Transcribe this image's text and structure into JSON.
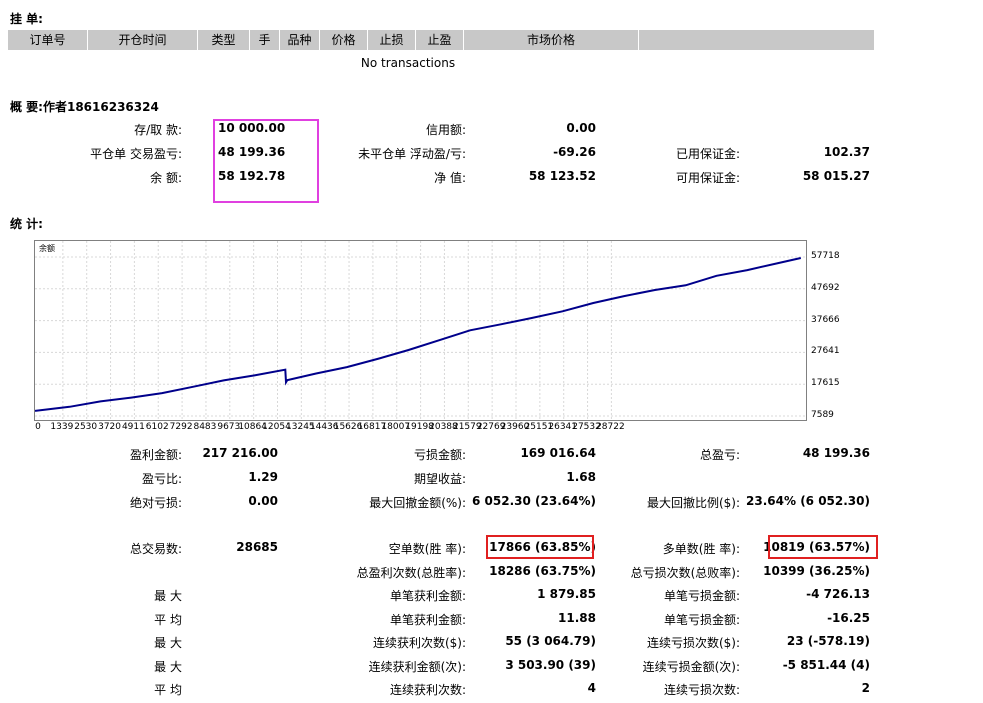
{
  "pending": {
    "title": "挂 单:",
    "columns": [
      "订单号",
      "开仓时间",
      "类型",
      "手",
      "品种",
      "价格",
      "止损",
      "止盈",
      "市场价格",
      ""
    ],
    "empty_text": "No transactions"
  },
  "summary": {
    "title": "概 要:作者18616236324",
    "rows": [
      [
        {
          "label": "存/取 款:",
          "value": "10 000.00"
        },
        {
          "label": "信用额:",
          "value": "0.00"
        },
        {
          "label": "",
          "value": ""
        }
      ],
      [
        {
          "label": "平仓单 交易盈亏:",
          "value": "48 199.36"
        },
        {
          "label": "未平仓单 浮动盈/亏:",
          "value": "-69.26"
        },
        {
          "label": "已用保证金:",
          "value": "102.37"
        }
      ],
      [
        {
          "label": "余 额:",
          "value": "58 192.78"
        },
        {
          "label": "净 值:",
          "value": "58 123.52"
        },
        {
          "label": "可用保证金:",
          "value": "58 015.27"
        }
      ]
    ],
    "highlight_color": "#e040e0"
  },
  "stats_title": "统 计:",
  "chart_data": {
    "type": "line",
    "legend": "余额",
    "x_ticks": [
      "0",
      "1339",
      "2530",
      "3720",
      "4911",
      "6102",
      "7292",
      "8483",
      "9673",
      "10864",
      "12054",
      "13245",
      "14436",
      "15626",
      "16817",
      "18007",
      "19198",
      "20388",
      "21579",
      "22769",
      "23960",
      "25151",
      "26341",
      "27532",
      "28722"
    ],
    "y_ticks": [
      "57718",
      "47692",
      "37666",
      "27641",
      "17615",
      "7589"
    ],
    "ylim": [
      7589,
      57718
    ],
    "xlim": [
      0,
      29800
    ],
    "grid": true,
    "line_color": "#00008b",
    "series": [
      {
        "x": [
          0,
          1339,
          2530,
          3720,
          4911,
          6102,
          7292,
          8483,
          9673,
          9700,
          9750,
          10864,
          12054,
          13245,
          14436,
          15626,
          16817,
          18007,
          19198,
          20388,
          21579,
          22769,
          23960,
          25151,
          26341,
          27532,
          28722,
          29600
        ],
        "y": [
          9200,
          10500,
          12200,
          13400,
          14800,
          16800,
          18800,
          20400,
          22200,
          18200,
          18900,
          21000,
          23000,
          25600,
          28400,
          31500,
          34600,
          36500,
          38500,
          40600,
          43200,
          45400,
          47300,
          48800,
          51800,
          53600,
          55800,
          57400
        ]
      }
    ]
  },
  "stats": {
    "rows_a": [
      [
        {
          "label": "盈利金额:",
          "value": "217 216.00"
        },
        {
          "label": "亏损金额:",
          "value": "169 016.64"
        },
        {
          "label": "总盈亏:",
          "value": "48 199.36"
        }
      ],
      [
        {
          "label": "盈亏比:",
          "value": "1.29"
        },
        {
          "label": "期望收益:",
          "value": "1.68"
        },
        {
          "label": "",
          "value": ""
        }
      ],
      [
        {
          "label": "绝对亏损:",
          "value": "0.00"
        },
        {
          "label": "最大回撤金额(%):",
          "value": "6 052.30 (23.64%)"
        },
        {
          "label": "最大回撤比例($):",
          "value": "23.64% (6 052.30)"
        }
      ]
    ],
    "rows_b": [
      [
        {
          "label": "总交易数:",
          "value": "28685"
        },
        {
          "label": "空单数(胜 率):",
          "value": "17866 (63.85%)"
        },
        {
          "label": "多单数(胜 率):",
          "value": "10819 (63.57%)"
        }
      ],
      [
        {
          "label": "",
          "value": ""
        },
        {
          "label": "总盈利次数(总胜率):",
          "value": "18286 (63.75%)"
        },
        {
          "label": "总亏损次数(总败率):",
          "value": "10399 (36.25%)"
        }
      ],
      [
        {
          "label": "最 大",
          "value": ""
        },
        {
          "label": "单笔获利金额:",
          "value": "1 879.85"
        },
        {
          "label": "单笔亏损金额:",
          "value": "-4 726.13"
        }
      ],
      [
        {
          "label": "平 均",
          "value": ""
        },
        {
          "label": "单笔获利金额:",
          "value": "11.88"
        },
        {
          "label": "单笔亏损金额:",
          "value": "-16.25"
        }
      ],
      [
        {
          "label": "最 大",
          "value": ""
        },
        {
          "label": "连续获利次数($):",
          "value": "55 (3 064.79)"
        },
        {
          "label": "连续亏损次数($):",
          "value": "23 (-578.19)"
        }
      ],
      [
        {
          "label": "最 大",
          "value": ""
        },
        {
          "label": "连续获利金额(次):",
          "value": "3 503.90 (39)"
        },
        {
          "label": "连续亏损金额(次):",
          "value": "-5 851.44 (4)"
        }
      ],
      [
        {
          "label": "平 均",
          "value": ""
        },
        {
          "label": "连续获利次数:",
          "value": "4"
        },
        {
          "label": "连续亏损次数:",
          "value": "2"
        }
      ]
    ],
    "highlight_color": "#e02020"
  }
}
